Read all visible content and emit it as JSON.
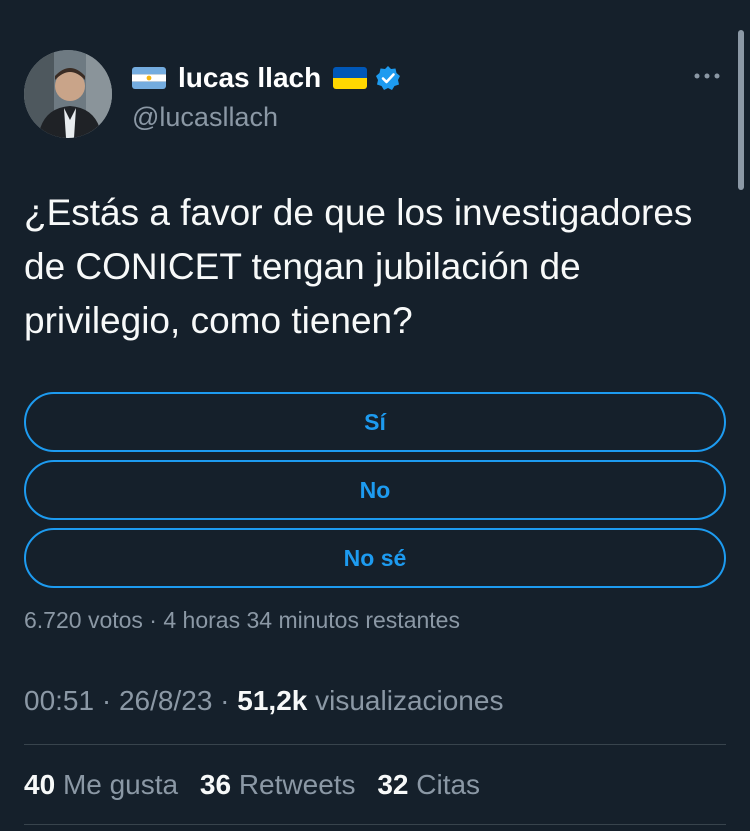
{
  "tweet": {
    "author": {
      "name": "lucas llach",
      "handle": "@lucasllach",
      "flag_left": "argentina-flag-icon",
      "flag_right": "ukraine-flag-icon",
      "verified": true
    },
    "text": "¿Estás a favor de que los investigadores de CONICET tengan jubilación de privilegio, como tienen?",
    "poll": {
      "options": [
        "Sí",
        "No",
        "No sé"
      ],
      "meta": "6.720 votos · 4 horas 34 minutos restantes"
    },
    "timestamp": {
      "time": "00:51",
      "sep1": " · ",
      "date": "26/8/23",
      "sep2": " · ",
      "views_count": "51,2k",
      "views_label": " visualizaciones"
    },
    "stats": {
      "likes_count": "40",
      "likes_label": "Me gusta",
      "retweets_count": "36",
      "retweets_label": "Retweets",
      "quotes_count": "32",
      "quotes_label": "Citas"
    }
  },
  "colors": {
    "background": "#15202b",
    "accent": "#1d9bf0",
    "secondary_text": "#8b98a5",
    "divider": "#38444d"
  }
}
